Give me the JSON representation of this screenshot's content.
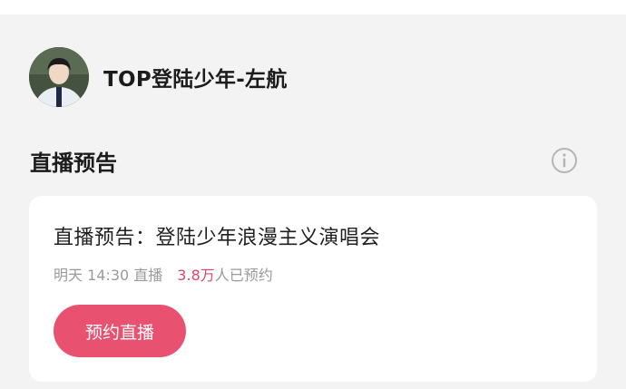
{
  "profile": {
    "name": "TOP登陆少年-左航"
  },
  "section": {
    "title": "直播预告",
    "info_icon": "info-icon"
  },
  "card": {
    "title": "直播预告：登陆少年浪漫主义演唱会",
    "meta_time": "明天 14:30 直播",
    "meta_count": "3.8万",
    "meta_suffix": "人已预约",
    "button_label": "预约直播"
  },
  "colors": {
    "accent": "#e8516f",
    "count_highlight": "#e0446c",
    "background": "#f3f3f3"
  }
}
